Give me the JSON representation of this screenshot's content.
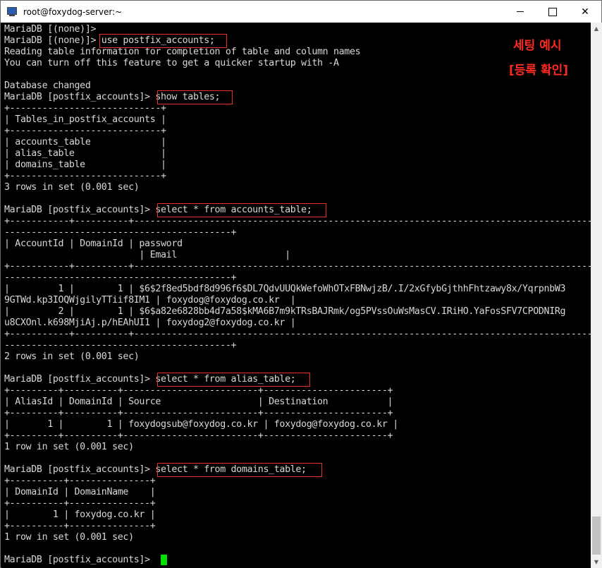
{
  "window": {
    "title": "root@foxydog-server:~",
    "minimize_icon": "minimize-icon",
    "maximize_icon": "maximize-icon",
    "close_symbol": "✕"
  },
  "terminal": {
    "lines": [
      "MariaDB [(none)]>",
      "MariaDB [(none)]> use postfix_accounts;",
      "Reading table information for completion of table and column names",
      "You can turn off this feature to get a quicker startup with -A",
      "",
      "Database changed",
      "MariaDB [postfix_accounts]> show tables;",
      "+----------------------------+",
      "| Tables_in_postfix_accounts |",
      "+----------------------------+",
      "| accounts_table             |",
      "| alias_table                |",
      "| domains_table              |",
      "+----------------------------+",
      "3 rows in set (0.001 sec)",
      "",
      "MariaDB [postfix_accounts]> select * from accounts_table;",
      "+-----------+----------+----------------------------------------------------------------------------------------------------------------------------+",
      "------------------------------------------+",
      "| AccountId | DomainId | password",
      "                         | Email                    |",
      "+-----------+----------+----------------------------------------------------------------------------------------------------------------------------+",
      "------------------------------------------+",
      "|         1 |        1 | $6$2f8ed5bdf8d996f6$DL7QdvUUQkWefoWhOTxFBNwjzB/.I/2xGfybGjthhFhtzawy8x/YqrpnbW3",
      "9GTWd.kp3IOQWjgilyTTiif8IM1 | foxydog@foxydog.co.kr  |",
      "|         2 |        1 | $6$a82e6828bb4d7a58$kMA6B7m9kTRsBAJRmk/og5PVssOuWsMasCV.IRiHO.YaFosSFV7CPODNIRg",
      "u8CXOnl.k698MjiAj.p/hEAhUI1 | foxydog2@foxydog.co.kr |",
      "+-----------+----------+----------------------------------------------------------------------------------------------------------------------------+",
      "------------------------------------------+",
      "2 rows in set (0.001 sec)",
      "",
      "MariaDB [postfix_accounts]> select * from alias_table;",
      "+---------+----------+-------------------------+-----------------------+",
      "| AliasId | DomainId | Source                  | Destination           |",
      "+---------+----------+-------------------------+-----------------------+",
      "|       1 |        1 | foxydogsub@foxydog.co.kr | foxydog@foxydog.co.kr |",
      "+---------+----------+-------------------------+-----------------------+",
      "1 row in set (0.001 sec)",
      "",
      "MariaDB [postfix_accounts]> select * from domains_table;",
      "+----------+---------------+",
      "| DomainId | DomainName    |",
      "+----------+---------------+",
      "|        1 | foxydog.co.kr |",
      "+----------+---------------+",
      "1 row in set (0.001 sec)",
      "",
      "MariaDB [postfix_accounts]> "
    ]
  },
  "annotation": {
    "line1": "세팅 예시",
    "line2": "[등록 확인]",
    "highlight_color": "#e8312b",
    "text_color": "#ff2a1f"
  },
  "colors": {
    "terminal_bg": "#000000",
    "terminal_fg": "#d8d8d8",
    "cursor": "#00e000"
  }
}
